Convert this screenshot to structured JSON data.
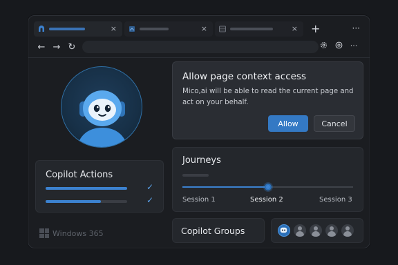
{
  "browser": {
    "tabs": [
      {
        "favicon": "copilot-icon",
        "active": true
      },
      {
        "favicon": "page-icon",
        "active": false
      },
      {
        "favicon": "grid-page-icon",
        "active": false
      }
    ],
    "tab_close_glyph": "×",
    "new_tab_glyph": "+",
    "more_glyph": "···",
    "nav": {
      "back": "←",
      "forward": "→",
      "refresh": "↻"
    },
    "toolbar_icons": [
      "settings-icon",
      "copilot-at-icon",
      "more-icon"
    ],
    "accent": "#3c82d0"
  },
  "copilot_actions": {
    "title": "Copilot Actions",
    "tasks": [
      {
        "progress": 1.0,
        "done": true
      },
      {
        "progress": 0.68,
        "done": true
      }
    ],
    "check_glyph": "✓"
  },
  "dialog": {
    "title": "Allow page context access",
    "body": "Mico,ai will be able to read the current page and act on your behalf.",
    "allow_label": "Allow",
    "cancel_label": "Cancel"
  },
  "journeys": {
    "title": "Journeys",
    "steps": [
      "Session 1",
      "Session 2",
      "Session 3"
    ],
    "active_step": 1,
    "progress": 0.5
  },
  "groups": {
    "title": "Copilot Groups",
    "members": [
      "copilot-bot",
      "person",
      "person",
      "person",
      "person"
    ]
  },
  "brand": {
    "label": "Windows 365"
  }
}
